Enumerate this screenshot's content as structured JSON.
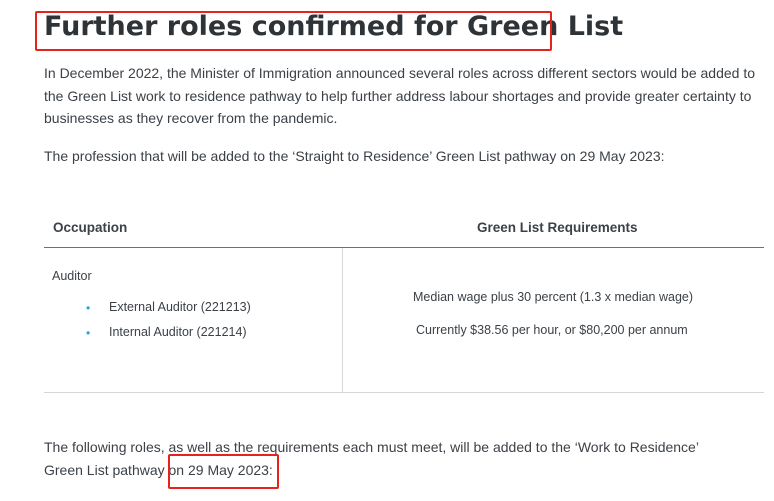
{
  "title": "Further roles confirmed for Green List",
  "paragraphs": {
    "intro": "In December 2022, the Minister of Immigration announced several roles across different sectors would be added to the Green List work to residence pathway to help further address labour shortages and provide greater certainty to businesses as they recover from the pandemic.",
    "profession": "The profession that will be added to the ‘Straight to Residence’ Green List pathway on 29 May 2023:",
    "following_line1": "The following roles, as well as the requirements each must meet, will be added to the ‘Work to Residence’",
    "following_line2_prefix": "Green List pathway ",
    "following_line2_date": "on 29 May 2023:"
  },
  "table": {
    "headers": {
      "occupation": "Occupation",
      "requirements": "Green List Requirements"
    },
    "rows": [
      {
        "occupation": "Auditor",
        "sub_roles": [
          "External Auditor (221213)",
          "Internal Auditor (221214)"
        ],
        "requirement_lines": [
          "Median wage plus 30 percent (1.3 x median wage)",
          "Currently $38.56 per hour, or $80,200 per annum"
        ]
      }
    ]
  },
  "colors": {
    "highlight": "#e8211b",
    "bullet": "#1ea6d7",
    "text": "#3b4147"
  }
}
